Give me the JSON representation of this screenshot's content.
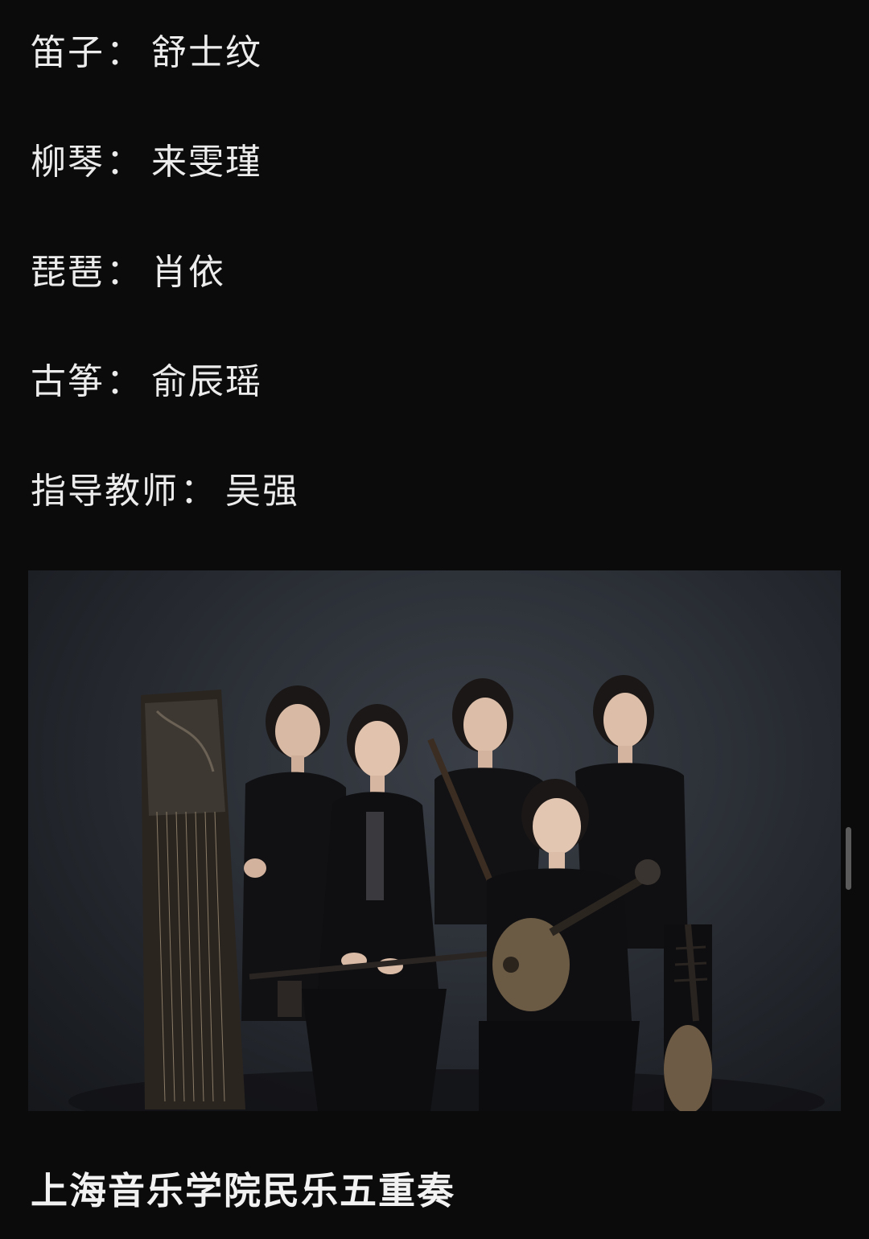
{
  "credits": [
    {
      "role": "笛子",
      "sep": "：",
      "name": "舒士纹"
    },
    {
      "role": "柳琴",
      "sep": "：",
      "name": "来雯瑾"
    },
    {
      "role": "琵琶",
      "sep": "：",
      "name": "肖依"
    },
    {
      "role": "古筝",
      "sep": "：",
      "name": "俞辰瑶"
    },
    {
      "role": "指导教师",
      "sep": "：",
      "name": "吴强"
    }
  ],
  "caption": "上海音乐学院民乐五重奏",
  "colors": {
    "background": "#0b0b0b",
    "text": "#ececec",
    "scrollbar": "#5b5b5b"
  }
}
